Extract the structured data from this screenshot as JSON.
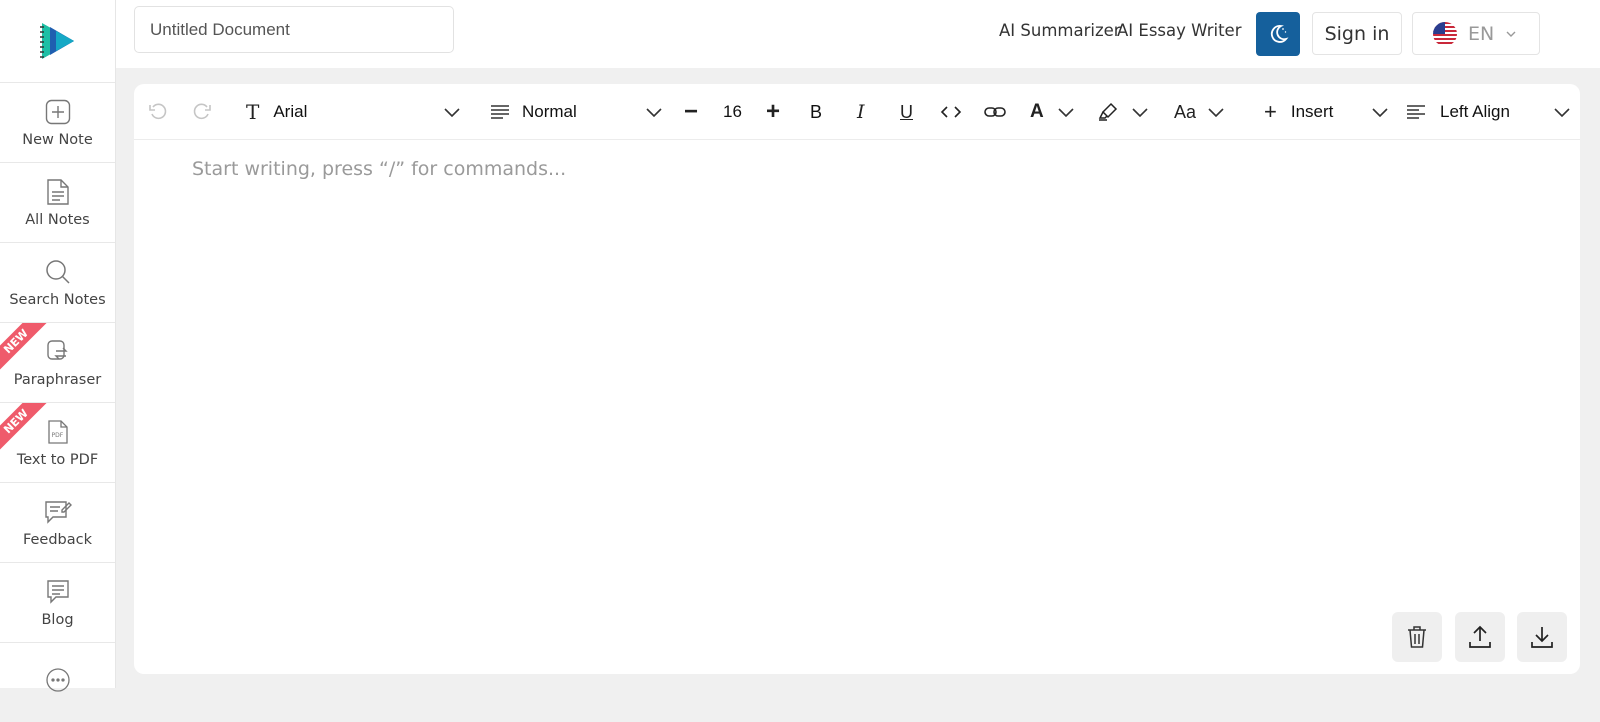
{
  "sidebar": {
    "items": [
      {
        "label": "New Note",
        "icon": "plus-square-icon"
      },
      {
        "label": "All Notes",
        "icon": "document-icon"
      },
      {
        "label": "Search Notes",
        "icon": "search-icon"
      },
      {
        "label": "Paraphraser",
        "icon": "paraphrase-icon",
        "badge": "NEW"
      },
      {
        "label": "Text to PDF",
        "icon": "pdf-icon",
        "badge": "NEW"
      },
      {
        "label": "Feedback",
        "icon": "feedback-icon"
      },
      {
        "label": "Blog",
        "icon": "blog-icon"
      },
      {
        "label": "",
        "icon": "more-icon"
      }
    ]
  },
  "header": {
    "doc_title": "Untitled Document",
    "links": [
      "AI Summarizer",
      "AI Essay Writer"
    ],
    "sign_in": "Sign in",
    "language": "EN"
  },
  "toolbar": {
    "font": "Arial",
    "block_style": "Normal",
    "font_size": "16",
    "bold": "B",
    "italic": "I",
    "underline": "U",
    "font_color": "A",
    "case": "Aa",
    "insert": "Insert",
    "align": "Left Align"
  },
  "editor": {
    "placeholder": "Start writing, press “/” for commands..."
  },
  "colors": {
    "accent": "#15609c",
    "badge": "#ef5b6b",
    "logo_teal": "#1dbfa5",
    "logo_blue": "#1f5fb0"
  }
}
